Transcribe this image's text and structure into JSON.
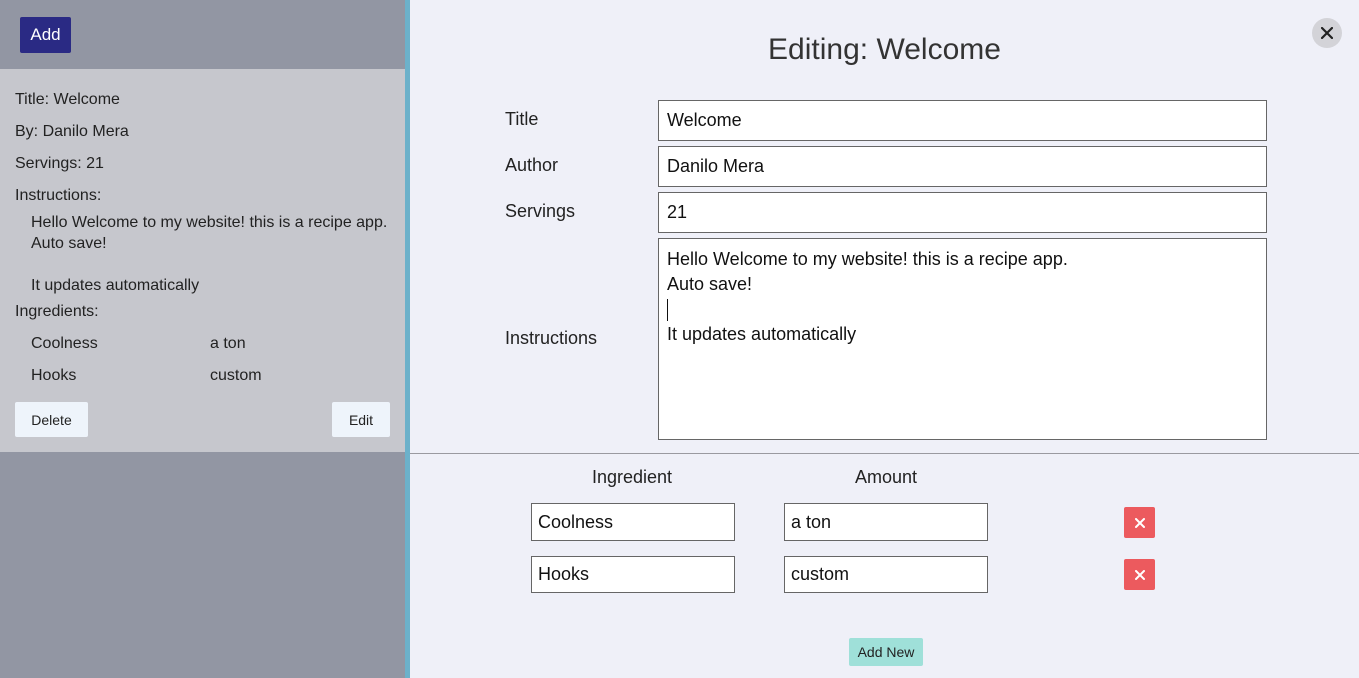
{
  "sidebar": {
    "add_label": "Add",
    "card": {
      "title_line": "Title: Welcome",
      "author_line": "By: Danilo Mera",
      "servings_line": "Servings: 21",
      "instructions_heading": "Instructions:",
      "instructions_lines": [
        "Hello Welcome to my website! this is a recipe app.",
        "Auto save!",
        "",
        "It updates automatically"
      ],
      "ingredients_heading": "Ingredients:",
      "ingredients": [
        {
          "name": "Coolness",
          "amount": "a ton"
        },
        {
          "name": "Hooks",
          "amount": "custom"
        }
      ],
      "delete_label": "Delete",
      "edit_label": "Edit"
    }
  },
  "editor": {
    "title": "Editing: Welcome",
    "fields": {
      "title_label": "Title",
      "title_value": "Welcome",
      "author_label": "Author",
      "author_value": "Danilo Mera",
      "servings_label": "Servings",
      "servings_value": "21",
      "instructions_label": "Instructions",
      "instructions_lines": [
        "Hello Welcome to my website! this is a recipe app.",
        "Auto save!",
        "",
        "It updates automatically"
      ]
    },
    "ingredient_header": "Ingredient",
    "amount_header": "Amount",
    "ingredients": [
      {
        "name": "Coolness",
        "amount": "a ton"
      },
      {
        "name": "Hooks",
        "amount": "custom"
      }
    ],
    "add_new_label": "Add New"
  },
  "colors": {
    "accent": "#2a2a84",
    "sidebar_bg": "#9296a3",
    "card_bg": "#c6c7cd",
    "divider": "#6cb1ca",
    "editor_bg": "#eff0f8",
    "delete_red": "#ec5a5e",
    "add_new_teal": "#9fe0d9"
  },
  "icons": {
    "close": "close-icon",
    "remove": "x-icon"
  }
}
